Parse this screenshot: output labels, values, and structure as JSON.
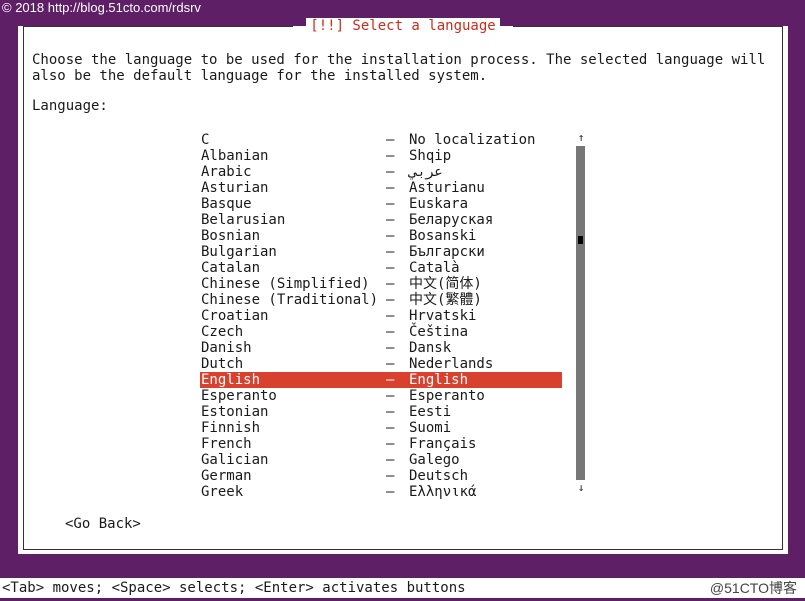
{
  "watermark_top": "© 2018 http://blog.51cto.com/rdsrv",
  "dialog": {
    "title": "[!!] Select a language",
    "intro": "Choose the language to be used for the installation process. The selected language will also be the default language for the installed system.",
    "language_label": "Language:"
  },
  "languages": [
    {
      "name": "C",
      "native": "No localization"
    },
    {
      "name": "Albanian",
      "native": "Shqip"
    },
    {
      "name": "Arabic",
      "native": "عربي"
    },
    {
      "name": "Asturian",
      "native": "Asturianu"
    },
    {
      "name": "Basque",
      "native": "Euskara"
    },
    {
      "name": "Belarusian",
      "native": "Беларуская"
    },
    {
      "name": "Bosnian",
      "native": "Bosanski"
    },
    {
      "name": "Bulgarian",
      "native": "Български"
    },
    {
      "name": "Catalan",
      "native": "Català"
    },
    {
      "name": "Chinese (Simplified)",
      "native": "中文(简体)"
    },
    {
      "name": "Chinese (Traditional)",
      "native": "中文(繁體)"
    },
    {
      "name": "Croatian",
      "native": "Hrvatski"
    },
    {
      "name": "Czech",
      "native": "Čeština"
    },
    {
      "name": "Danish",
      "native": "Dansk"
    },
    {
      "name": "Dutch",
      "native": "Nederlands"
    },
    {
      "name": "English",
      "native": "English"
    },
    {
      "name": "Esperanto",
      "native": "Esperanto"
    },
    {
      "name": "Estonian",
      "native": "Eesti"
    },
    {
      "name": "Finnish",
      "native": "Suomi"
    },
    {
      "name": "French",
      "native": "Français"
    },
    {
      "name": "Galician",
      "native": "Galego"
    },
    {
      "name": "German",
      "native": "Deutsch"
    },
    {
      "name": "Greek",
      "native": "Ελληνικά"
    }
  ],
  "separator": "–",
  "selected_language": "English",
  "go_back_label": "<Go Back>",
  "hint": "<Tab> moves; <Space> selects; <Enter> activates buttons",
  "watermark_bottom": "@51CTO博客",
  "colors": {
    "background": "#5f1f66",
    "selection": "#d8412d",
    "title": "#cc2b1d"
  },
  "icons": {
    "scroll_up": "up-arrow-icon",
    "scroll_down": "down-arrow-icon"
  }
}
